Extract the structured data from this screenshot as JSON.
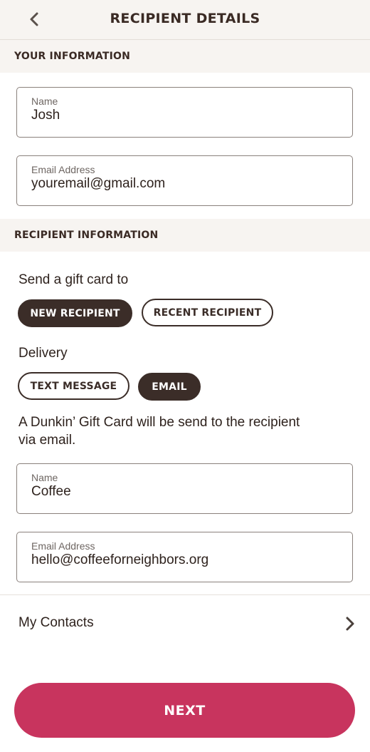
{
  "header": {
    "title": "RECIPIENT DETAILS",
    "back_icon": "chevron-left-icon"
  },
  "your_info": {
    "section_title": "YOUR INFORMATION",
    "name_label": "Name",
    "name_value": "Josh",
    "email_label": "Email Address",
    "email_value": "youremail@gmail.com"
  },
  "recipient_info": {
    "section_title": "RECIPIENT INFORMATION",
    "send_to_label": "Send a gift card to",
    "send_to_options": [
      "NEW RECIPIENT",
      "RECENT RECIPIENT"
    ],
    "send_to_selected": "NEW RECIPIENT",
    "delivery_label": "Delivery",
    "delivery_options": [
      "TEXT MESSAGE",
      "EMAIL"
    ],
    "delivery_selected": "EMAIL",
    "info_line1": "A Dunkin’ Gift Card will be send to the recipient",
    "info_line2": "via email.",
    "name_label": "Name",
    "name_value": "Coffee",
    "email_label": "Email Address",
    "email_value": "hello@coffeeforneighbors.org"
  },
  "contacts": {
    "label": "My Contacts",
    "icon": "chevron-right-icon"
  },
  "footer": {
    "next_label": "NEXT"
  },
  "colors": {
    "brand_dark": "#3b2d28",
    "accent_pink": "#c8345e",
    "section_bg": "#f7f4f1"
  }
}
